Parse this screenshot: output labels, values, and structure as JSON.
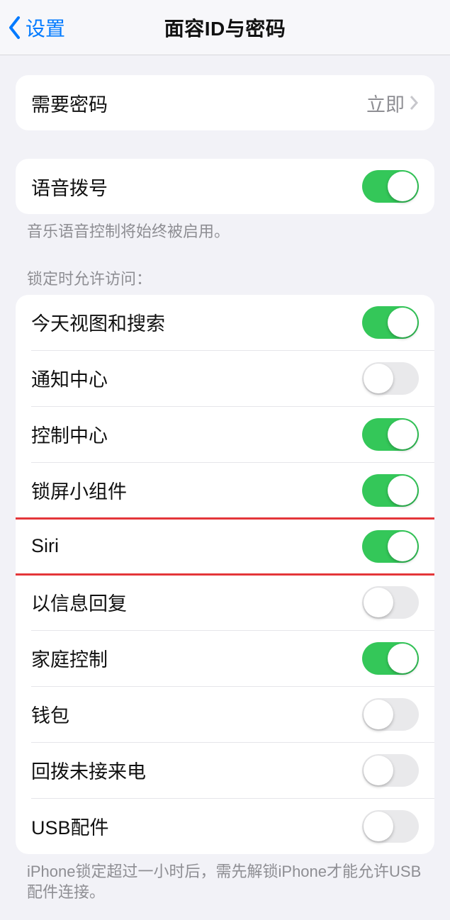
{
  "nav": {
    "back_label": "设置",
    "title": "面容ID与密码"
  },
  "require_passcode": {
    "label": "需要密码",
    "value": "立即"
  },
  "voice_dial": {
    "label": "语音拨号",
    "on": true,
    "footer": "音乐语音控制将始终被启用。"
  },
  "lock_screen_section": {
    "header": "锁定时允许访问：",
    "items": [
      {
        "key": "today",
        "label": "今天视图和搜索",
        "on": true
      },
      {
        "key": "notif",
        "label": "通知中心",
        "on": false
      },
      {
        "key": "control",
        "label": "控制中心",
        "on": true
      },
      {
        "key": "widgets",
        "label": "锁屏小组件",
        "on": true
      },
      {
        "key": "siri",
        "label": "Siri",
        "on": true
      },
      {
        "key": "reply_msg",
        "label": "以信息回复",
        "on": false
      },
      {
        "key": "home",
        "label": "家庭控制",
        "on": true
      },
      {
        "key": "wallet",
        "label": "钱包",
        "on": false
      },
      {
        "key": "return_call",
        "label": "回拨未接来电",
        "on": false
      },
      {
        "key": "usb",
        "label": "USB配件",
        "on": false
      }
    ],
    "footer": "iPhone锁定超过一小时后，需先解锁iPhone才能允许USB配件连接。"
  },
  "highlighted_rows": [
    "voice_dial",
    "siri"
  ]
}
